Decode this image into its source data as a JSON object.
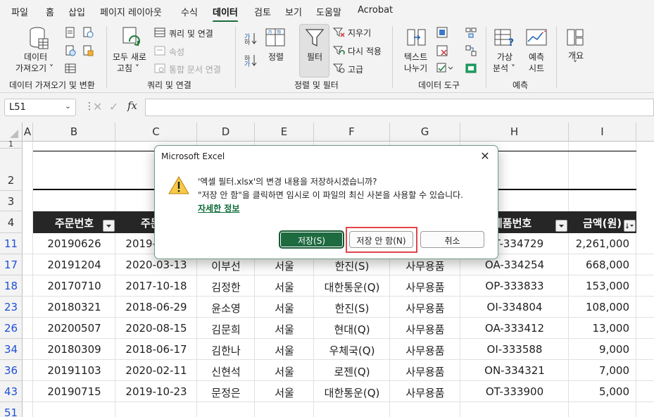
{
  "menu": {
    "tabs": [
      "파일",
      "홈",
      "삽입",
      "페이지 레이아웃",
      "수식",
      "데이터",
      "검토",
      "보기",
      "도움말",
      "Acrobat"
    ],
    "active": "데이터"
  },
  "ribbon": {
    "get_data_l1": "데이터",
    "get_data_l2": "가져오기 ˅",
    "refresh_l1": "모두 새로",
    "refresh_l2": "고침 ˅",
    "queries_connections": "쿼리 및 연결",
    "properties": "속성",
    "edit_links": "통합 문서 연결",
    "sort": "정렬",
    "filter": "필터",
    "clear": "지우기",
    "reapply": "다시 적용",
    "advanced": "고급",
    "text_to_columns_l1": "텍스트",
    "text_to_columns_l2": "나누기",
    "whatif_l1": "가상",
    "whatif_l2": "분석 ˅",
    "forecast_l1": "예측",
    "forecast_l2": "시트",
    "outline": "개요",
    "outline_arrow": "˅",
    "groups": [
      "데이터 가져오기 및 변환",
      "쿼리 및 연결",
      "정렬 및 필터",
      "데이터 도구",
      "예측"
    ]
  },
  "formula_bar": {
    "name_box": "L51",
    "fx": "fx"
  },
  "sheet": {
    "columns": [
      "A",
      "B",
      "C",
      "D",
      "E",
      "F",
      "G",
      "H",
      "I"
    ],
    "row_numbers": [
      "1",
      "2",
      "3",
      "4",
      "11",
      "17",
      "18",
      "23",
      "26",
      "34",
      "36",
      "43",
      "51"
    ],
    "header": [
      "주문번호",
      "주문일",
      "",
      "",
      "",
      "",
      "제품번호",
      "금액(원)"
    ],
    "rows": [
      [
        "20190626",
        "2019-06-26",
        "",
        "서울",
        "",
        "사무용품",
        "OT-334729",
        "2,261,000"
      ],
      [
        "20191204",
        "2020-03-13",
        "이부선",
        "서울",
        "한진(S)",
        "사무용품",
        "OA-334254",
        "668,000"
      ],
      [
        "20170710",
        "2017-10-18",
        "김정한",
        "서울",
        "대한통운(Q)",
        "사무용품",
        "OP-333833",
        "153,000"
      ],
      [
        "20180321",
        "2018-06-29",
        "윤소영",
        "서울",
        "한진(S)",
        "사무용품",
        "OI-334804",
        "108,000"
      ],
      [
        "20200507",
        "2020-08-15",
        "김문희",
        "서울",
        "현대(Q)",
        "사무용품",
        "OA-333412",
        "13,000"
      ],
      [
        "20180309",
        "2018-06-17",
        "김한나",
        "서울",
        "우체국(Q)",
        "사무용품",
        "OI-333588",
        "9,000"
      ],
      [
        "20191103",
        "2020-02-11",
        "신현석",
        "서울",
        "로젠(Q)",
        "사무용품",
        "ON-334321",
        "7,000"
      ],
      [
        "20190715",
        "2019-10-23",
        "문정은",
        "서울",
        "대한통운(Q)",
        "사무용품",
        "OT-333900",
        "5,000"
      ]
    ]
  },
  "dialog": {
    "title": "Microsoft Excel",
    "close": "✕",
    "message1": "'엑셀 필터.xlsx'의 변경 내용을 저장하시겠습니까?",
    "message2": "\"저장 안 함\"을 클릭하면 임시로 이 파일의 최신 사본을 사용할 수 있습니다.",
    "link": "자세한 정보",
    "save": "저장(S)",
    "dont_save": "저장 안 함(N)",
    "cancel": "취소"
  },
  "colors": {
    "accent": "#1e6b40",
    "header_fill": "#262626",
    "filtered_row_number": "#1d4fd6",
    "highlight": "#e0454e"
  }
}
